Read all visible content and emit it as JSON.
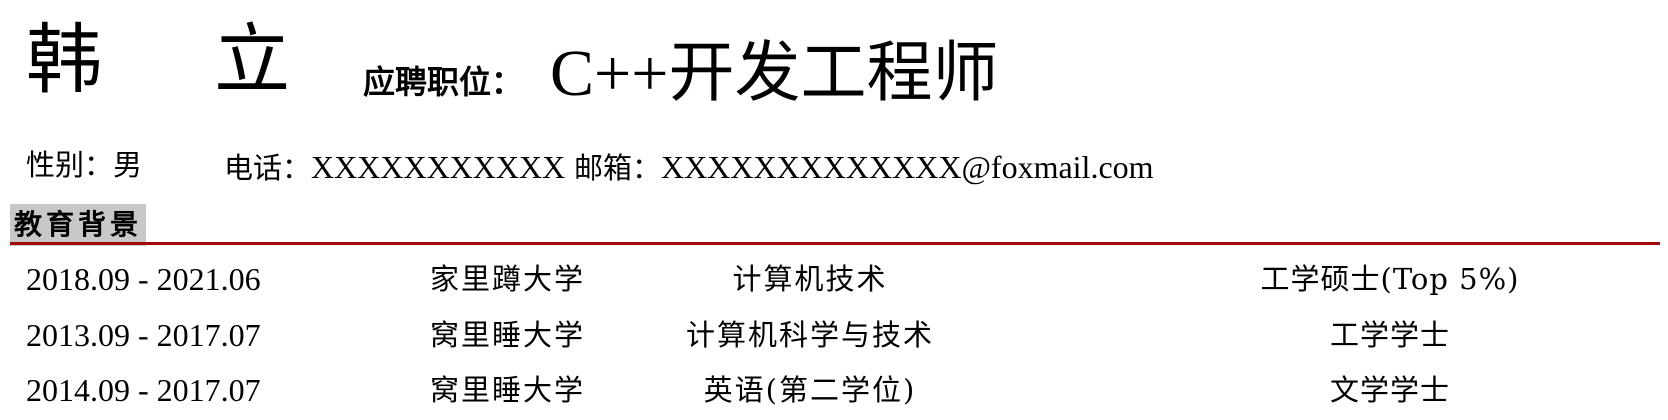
{
  "header": {
    "name": "韩 立",
    "position_label": "应聘职位：",
    "position_value_latin": "C++",
    "position_value_cjk": "开发工程师"
  },
  "contact": {
    "gender_label": "性别：",
    "gender_value": "男",
    "phone_label": "电话：",
    "phone_value": "XXXXXXXXXXX",
    "email_label": "邮箱：",
    "email_value": "XXXXXXXXXXXXX@foxmail.com"
  },
  "education": {
    "section_title": "教育背景",
    "accent_color": "#a00a0a",
    "header_bg_color": "#c8c8c8",
    "rows": [
      {
        "dates": "2018.09 - 2021.06",
        "school": "家里蹲大学",
        "major": "计算机技术",
        "degree": "工学硕士(Top 5%)"
      },
      {
        "dates": "2013.09 - 2017.07",
        "school": "窝里睡大学",
        "major": "计算机科学与技术",
        "degree": "工学学士"
      },
      {
        "dates": "2014.09 - 2017.07",
        "school": "窝里睡大学",
        "major": "英语(第二学位)",
        "degree": "文学学士"
      }
    ]
  }
}
